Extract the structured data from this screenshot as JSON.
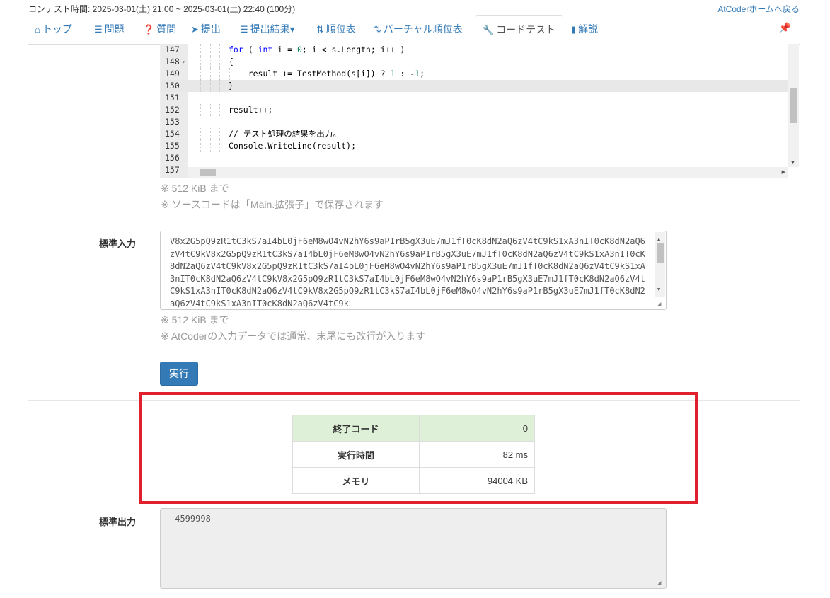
{
  "header": {
    "contest_time": "コンテスト時間: 2025-03-01(土) 21:00 ~ 2025-03-01(土) 22:40 (100分)",
    "home_link": "AtCoderホームへ戻る"
  },
  "nav": {
    "tabs": [
      {
        "label": "トップ",
        "icon": "home-icon"
      },
      {
        "label": "問題",
        "icon": "list-icon"
      },
      {
        "label": "質問",
        "icon": "question-icon"
      },
      {
        "label": "提出",
        "icon": "send-icon"
      },
      {
        "label": "提出結果▾",
        "icon": "list-icon"
      },
      {
        "label": "順位表",
        "icon": "sort-icon"
      },
      {
        "label": "バーチャル順位表",
        "icon": "sort-icon"
      },
      {
        "label": "コードテスト",
        "icon": "wrench-icon",
        "active": true
      },
      {
        "label": "解説",
        "icon": "book-icon"
      }
    ],
    "pin_icon": "pin-icon"
  },
  "editor": {
    "lines": [
      {
        "n": "147",
        "code": "for ( int i = 0; i < s.Length; i++ )"
      },
      {
        "n": "148",
        "code": "{",
        "fold": "▾"
      },
      {
        "n": "149",
        "code": "    result += TestMethod(s[i]) ? 1 : -1;"
      },
      {
        "n": "150",
        "code": "}",
        "active": true
      },
      {
        "n": "151",
        "code": ""
      },
      {
        "n": "152",
        "code": "result++;"
      },
      {
        "n": "153",
        "code": ""
      },
      {
        "n": "154",
        "code": "// テスト処理の結果を出力。"
      },
      {
        "n": "155",
        "code": "Console.WriteLine(result);"
      },
      {
        "n": "156",
        "code": ""
      },
      {
        "n": "157",
        "code": ""
      }
    ],
    "note_size": "※ 512 KiB まで",
    "note_save": "※ ソースコードは「Main.拡張子」で保存されます"
  },
  "stdin": {
    "label": "標準入力",
    "value": "V8x2G5pQ9zR1tC3kS7aI4bL0jF6eM8wO4vN2hY6s9aP1rB5gX3uE7mJ1fT0cK8dN2aQ6zV4tC9kS1xA3nIT0cK8dN2aQ6zV4tC9kV8x2G5pQ9zR1tC3kS7aI4bL0jF6eM8wO4vN2hY6s9aP1rB5gX3uE7mJ1fT0cK8dN2aQ6zV4tC9kS1xA3nIT0cK8dN2aQ6zV4tC9kV8x2G5pQ9zR1tC3kS7aI4bL0jF6eM8wO4vN2hY6s9aP1rB5gX3uE7mJ1fT0cK8dN2aQ6zV4tC9kS1xA3nIT0cK8dN2aQ6zV4tC9kV8x2G5pQ9zR1tC3kS7aI4bL0jF6eM8wO4vN2hY6s9aP1rB5gX3uE7mJ1fT0cK8dN2aQ6zV4tC9kS1xA3nIT0cK8dN2aQ6zV4tC9kV8x2G5pQ9zR1tC3kS7aI4bL0jF6eM8wO4vN2hY6s9aP1rB5gX3uE7mJ1fT0cK8dN2aQ6zV4tC9kS1xA3nIT0cK8dN2aQ6zV4tC9k",
    "note_size": "※ 512 KiB まで",
    "note_newline": "※ AtCoderの入力データでは通常、末尾にも改行が入ります"
  },
  "run_button": "実行",
  "result": {
    "rows": [
      {
        "key": "終了コード",
        "value": "0"
      },
      {
        "key": "実行時間",
        "value": "82 ms"
      },
      {
        "key": "メモリ",
        "value": "94004 KB"
      }
    ]
  },
  "stdout": {
    "label": "標準出力",
    "value": "-4599998"
  },
  "colors": {
    "link": "#337ab7",
    "primary_button": "#337ab7",
    "highlight_border": "#e0202c",
    "success_row": "#dff0d8"
  }
}
